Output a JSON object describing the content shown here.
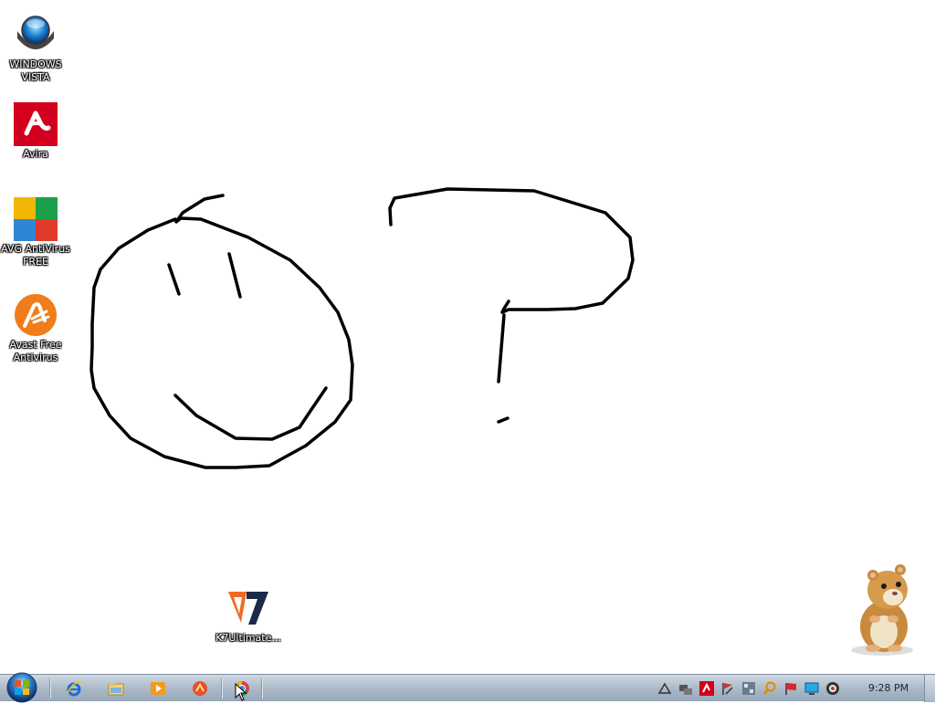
{
  "desktop": {
    "icons": [
      {
        "label": "WINDOWS VISTA",
        "icon": "vista-orb-icon"
      },
      {
        "label": "Avira",
        "icon": "avira-icon"
      },
      {
        "label": "AVG AntiVirus FREE",
        "icon": "avg-icon"
      },
      {
        "label": "Avast Free Antivirus",
        "icon": "avast-icon"
      },
      {
        "label": "K7Ultimate...",
        "icon": "k7-icon"
      }
    ],
    "drawing": [
      "smiley-face",
      "question-mark"
    ],
    "mascot": "hamster"
  },
  "taskbar": {
    "start": "windows-start-orb-icon",
    "pinned": [
      "internet-explorer-icon",
      "file-explorer-icon",
      "media-player-icon",
      "app-icon",
      "chrome-icon"
    ],
    "tray": [
      "tray-up-arrow-icon",
      "network-icon",
      "avira-tray-icon",
      "flag-icon",
      "av-tray-icon",
      "search-tray-icon",
      "action-center-icon",
      "display-icon",
      "volume-icon"
    ],
    "clock": "9:28 PM"
  },
  "colors": {
    "taskbar": "#aab8c7",
    "avira_red": "#d2001e",
    "avast_orange": "#f07d19",
    "k7_orange": "#f06a21"
  }
}
